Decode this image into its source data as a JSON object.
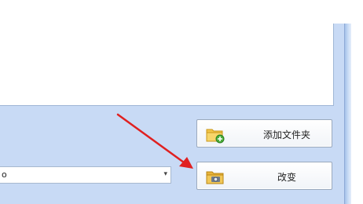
{
  "folder_picker": {
    "path_combo": {
      "value": "o",
      "expand_icon": "chevron-down-icon"
    }
  },
  "buttons": {
    "add_folder": {
      "label": "添加文件夹",
      "icon": "folder-add-icon"
    },
    "change": {
      "label": "改变",
      "icon": "folder-camera-icon"
    }
  },
  "annotation": {
    "arrow_color": "#e02020"
  },
  "colors": {
    "window_bg": "#c8daf5",
    "panel_bg": "#ffffff"
  }
}
